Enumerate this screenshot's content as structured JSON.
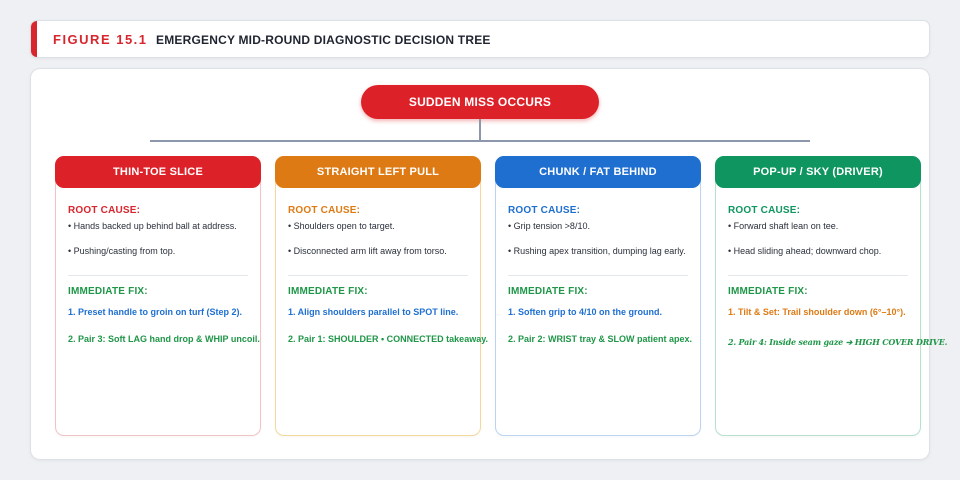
{
  "figure": {
    "number": "FIGURE 15.1",
    "title": "EMERGENCY MID-ROUND DIAGNOSTIC DECISION TREE"
  },
  "root": {
    "label": "SUDDEN MISS OCCURS"
  },
  "labels": {
    "root_cause": "ROOT CAUSE:",
    "immediate_fix": "IMMEDIATE FIX:"
  },
  "colors": {
    "accent_red": "#d8262e",
    "red": "#dd2128",
    "orange": "#de7a13",
    "blue": "#1f6fd0",
    "green": "#0f9660",
    "root_cause_label": "#1f4f9c",
    "fix_label": "#1f9648"
  },
  "branches": [
    {
      "title": "THIN-TOE SLICE",
      "causes": [
        "• Hands backed up behind ball at address.",
        "• Pushing/casting from top."
      ],
      "fixes": [
        "1. Preset handle to groin on turf (Step 2).",
        "2. Pair 3: Soft LAG hand drop & WHIP uncoil."
      ]
    },
    {
      "title": "STRAIGHT LEFT PULL",
      "causes": [
        "• Shoulders open to target.",
        "• Disconnected arm lift away from torso."
      ],
      "fixes": [
        "1. Align shoulders parallel to SPOT line.",
        "2. Pair 1: SHOULDER • CONNECTED takeaway."
      ]
    },
    {
      "title": "CHUNK / FAT BEHIND",
      "causes": [
        "• Grip tension >8/10.",
        "• Rushing apex transition, dumping lag early."
      ],
      "fixes": [
        "1. Soften grip to 4/10 on the ground.",
        "2. Pair 2: WRIST tray & SLOW patient apex."
      ]
    },
    {
      "title": "POP-UP / SKY (DRIVER)",
      "causes": [
        "• Forward shaft lean on tee.",
        "• Head sliding ahead; downward chop."
      ],
      "fixes": [
        "1. Tilt & Set: Trail shoulder down (6°–10°).",
        "2. Pair 4: Inside seam gaze ➔ HIGH COVER DRIVE."
      ]
    }
  ]
}
